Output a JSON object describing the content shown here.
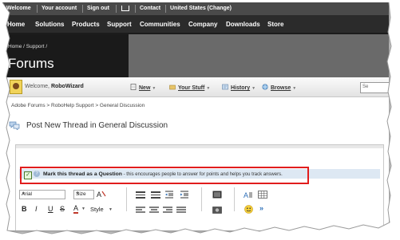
{
  "utility_bar": {
    "welcome": "Welcome",
    "account": "Your account",
    "signout": "Sign out",
    "contact": "Contact",
    "region": "United States (Change)"
  },
  "main_nav": [
    "Home",
    "Solutions",
    "Products",
    "Support",
    "Communities",
    "Company",
    "Downloads",
    "Store"
  ],
  "hero": {
    "breadcrumb": "Home  /  Support  /",
    "title": "Forums"
  },
  "forum_toolbar": {
    "welcome_prefix": "Welcome,",
    "username": "RoboWizard",
    "new": "New",
    "your_stuff": "Your Stuff",
    "history": "History",
    "browse": "Browse",
    "search_placeholder": "Se"
  },
  "breadcrumb": "Adobe Forums > RoboHelp Support > General Discussion",
  "page_title": "Post New Thread in General Discussion",
  "question_option": {
    "label": "Mark this thread as a Question",
    "description": " - this encourages people to answer for points and helps you track answers."
  },
  "editor_toolbar": {
    "font": "Arial",
    "size": "Size",
    "style": "Style",
    "bold": "B",
    "italic": "I",
    "underline": "U",
    "strike": "S",
    "font_color": "A",
    "more": "»"
  },
  "colors": {
    "accent_red": "#e11d1d",
    "nav_dark": "#2b2b2b",
    "hero_dark": "#1a1a1a"
  }
}
